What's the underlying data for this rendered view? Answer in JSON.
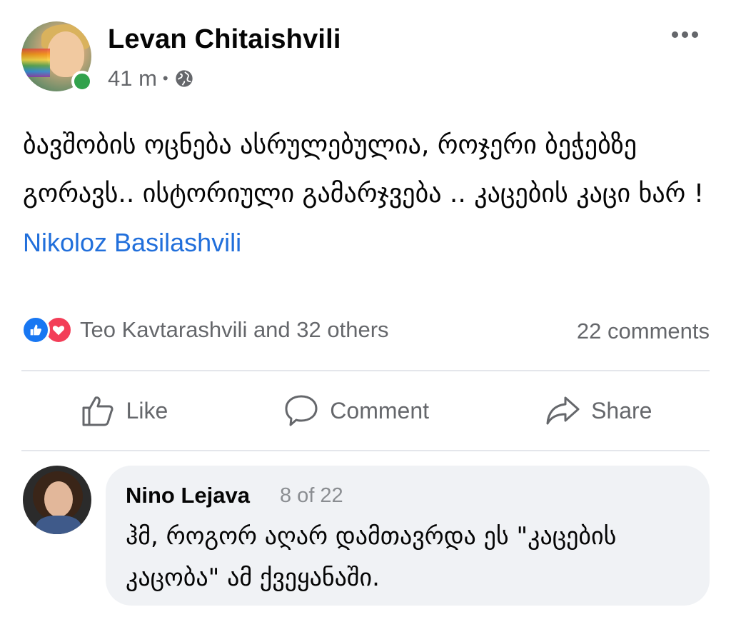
{
  "post": {
    "author": "Levan Chitaishvili",
    "time": "41 m",
    "separator": "•",
    "privacy_icon": "globe-icon",
    "more_icon": "more-options-icon",
    "text": "ბავშობის ოცნება ასრულებულია,  როჯერი ბეჭებზე გორავს..  ისტორიული გამარჯვება .. კაცების კაცი ხარ ! ",
    "mention": "Nikoloz Basilashvili"
  },
  "reactions": {
    "icons": [
      "like-reaction-icon",
      "love-reaction-icon"
    ],
    "summary": "Teo Kavtarashvili and 32 others",
    "comments_count": "22 comments"
  },
  "actions": {
    "like_label": "Like",
    "comment_label": "Comment",
    "share_label": "Share"
  },
  "comment": {
    "author": "Nino Lejava",
    "index": "8 of 22",
    "text": "ჰმ, როგორ აღარ დამთავრდა ეს \"კაცების კაცობა\" ამ ქვეყანაში."
  },
  "colors": {
    "link": "#216fdb",
    "secondary_text": "#65676b",
    "online": "#31a24c",
    "like": "#1877f2",
    "love": "#f33e58",
    "bubble": "#f0f2f5"
  }
}
